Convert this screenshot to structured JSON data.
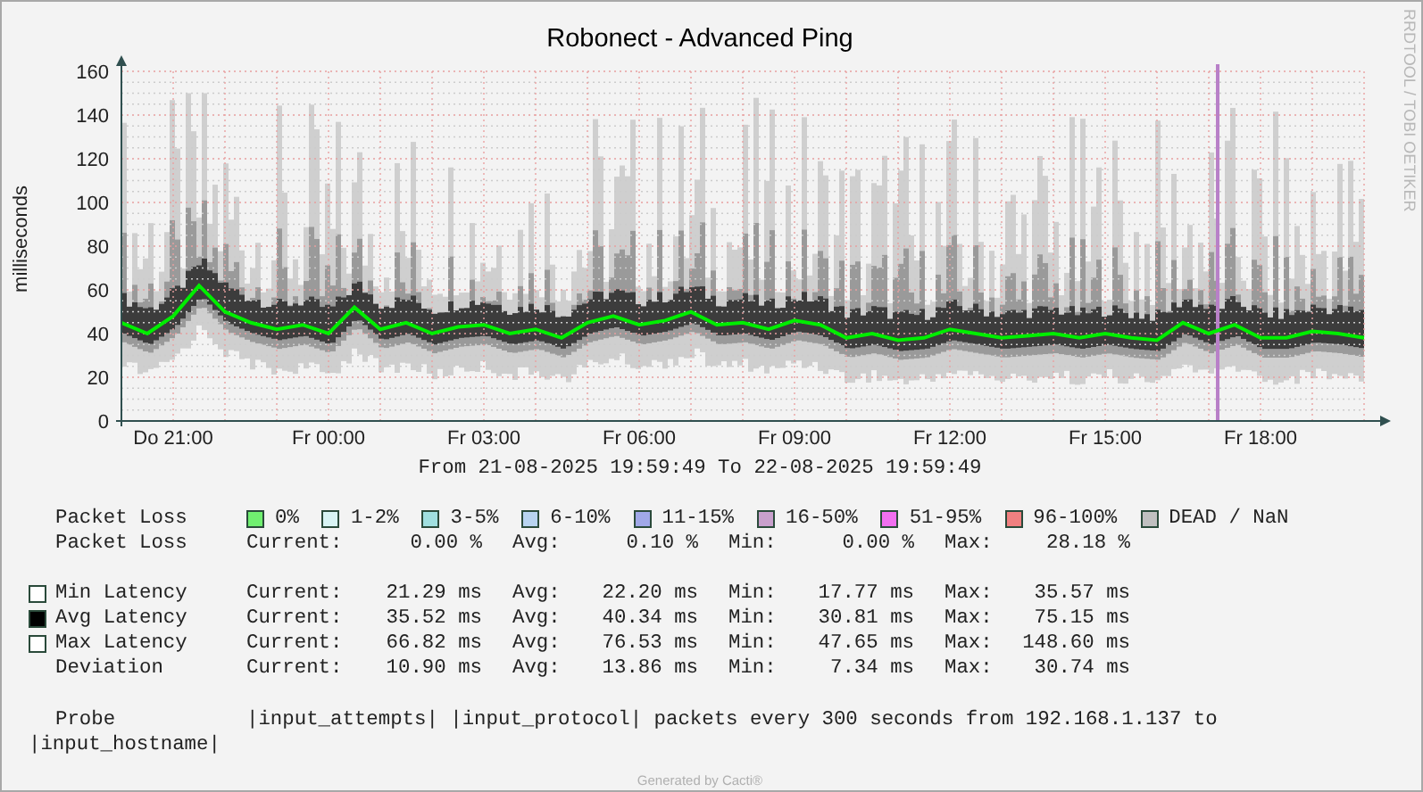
{
  "title": "Robonect - Advanced Ping",
  "side_note": "RRDTOOL / TOBI OETIKER",
  "chart": {
    "chart_data": {
      "type": "line",
      "ylabel": "milliseconds",
      "categories": [
        null,
        null,
        "Do 21:00",
        null,
        null,
        null,
        null,
        null,
        "Fr 00:00",
        null,
        null,
        null,
        null,
        null,
        "Fr 03:00",
        null,
        null,
        null,
        null,
        null,
        "Fr 06:00",
        null,
        null,
        null,
        null,
        null,
        "Fr 09:00",
        null,
        null,
        null,
        null,
        null,
        "Fr 12:00",
        null,
        null,
        null,
        null,
        null,
        "Fr 15:00",
        null,
        null,
        null,
        null,
        null,
        "Fr 18:00",
        null,
        null,
        null,
        null
      ],
      "series": [
        {
          "color": "#00ee00",
          "values": [
            45,
            40,
            48,
            62,
            50,
            45,
            42,
            44,
            40,
            52,
            42,
            45,
            40,
            43,
            44,
            40,
            42,
            38,
            45,
            48,
            44,
            46,
            50,
            44,
            45,
            42,
            46,
            44,
            38,
            40,
            37,
            38,
            42,
            40,
            38,
            39,
            40,
            38,
            40,
            38,
            37,
            45,
            40,
            44,
            38,
            38,
            41,
            40,
            38
          ]
        }
      ],
      "ylim": [
        0,
        160
      ],
      "yticks": [
        0,
        20,
        40,
        60,
        80,
        100,
        120,
        140,
        160
      ],
      "grid": true
    }
  },
  "period": "From 21-08-2025 19:59:49 To 22-08-2025 19:59:49",
  "loss_legend": {
    "label": "Packet Loss",
    "items": [
      {
        "label": "0%",
        "color": "#70f070"
      },
      {
        "label": "1-2%",
        "color": "#d8f4f4"
      },
      {
        "label": "3-5%",
        "color": "#a0e0e0"
      },
      {
        "label": "6-10%",
        "color": "#b8d4f0"
      },
      {
        "label": "11-15%",
        "color": "#a0a8e8"
      },
      {
        "label": "16-50%",
        "color": "#c8a0cc"
      },
      {
        "label": "51-95%",
        "color": "#f070f0"
      },
      {
        "label": "96-100%",
        "color": "#f08080"
      },
      {
        "label": "DEAD / NaN",
        "color": "#c0c0c0"
      }
    ]
  },
  "stats": [
    {
      "kind": "plain",
      "label": "Packet Loss",
      "cells": [
        {
          "name": "Current:",
          "value": "0.00 %"
        },
        {
          "name": "Avg:",
          "value": "0.10 %"
        },
        {
          "name": "Min:",
          "value": "0.00 %"
        },
        {
          "name": "Max:",
          "value": "28.18 %"
        }
      ]
    },
    {
      "kind": "outline",
      "label": "Min Latency",
      "cells": [
        {
          "name": "Current:",
          "value": "21.29 ms"
        },
        {
          "name": "Avg:",
          "value": "22.20 ms"
        },
        {
          "name": "Min:",
          "value": "17.77 ms"
        },
        {
          "name": "Max:",
          "value": "35.57 ms"
        }
      ]
    },
    {
      "kind": "filled",
      "label": "Avg Latency",
      "cells": [
        {
          "name": "Current:",
          "value": "35.52 ms"
        },
        {
          "name": "Avg:",
          "value": "40.34 ms"
        },
        {
          "name": "Min:",
          "value": "30.81 ms"
        },
        {
          "name": "Max:",
          "value": "75.15 ms"
        }
      ]
    },
    {
      "kind": "outline",
      "label": "Max Latency",
      "cells": [
        {
          "name": "Current:",
          "value": "66.82 ms"
        },
        {
          "name": "Avg:",
          "value": "76.53 ms"
        },
        {
          "name": "Min:",
          "value": "47.65 ms"
        },
        {
          "name": "Max:",
          "value": "148.60 ms"
        }
      ]
    },
    {
      "kind": "plain",
      "label": "Deviation",
      "cells": [
        {
          "name": "Current:",
          "value": "10.90 ms"
        },
        {
          "name": "Avg:",
          "value": "13.86 ms"
        },
        {
          "name": "Min:",
          "value": "7.34 ms"
        },
        {
          "name": "Max:",
          "value": "30.74 ms"
        }
      ]
    }
  ],
  "probe": {
    "label": "Probe",
    "lines": [
      "|input_attempts| |input_protocol| packets every 300 seconds from 192.168.1.137 to",
      "|input_hostname|"
    ]
  },
  "footer": "Generated by Cacti®"
}
